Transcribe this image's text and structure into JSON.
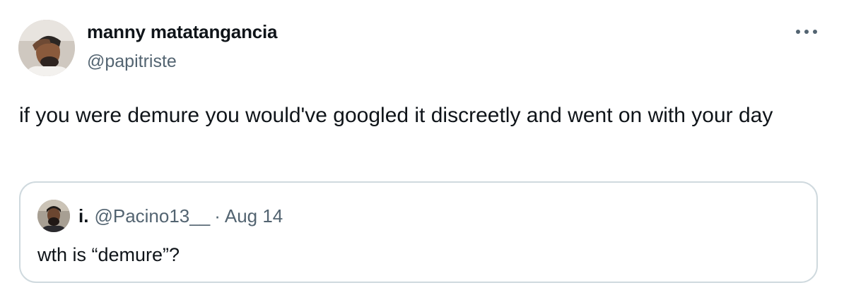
{
  "tweet": {
    "author_name": "manny matatangancia",
    "author_handle": "@papitriste",
    "more_icon": "more-horizontal-icon",
    "text": "if you were demure you would've googled it discreetly and went on with your day"
  },
  "quote": {
    "author_name": "i.",
    "author_handle": "@Pacino13__",
    "separator": "·",
    "date": "Aug 14",
    "text": "wth is “demure”?"
  },
  "colors": {
    "text_primary": "#0f1419",
    "text_secondary": "#536471",
    "card_border": "#cfd9de"
  }
}
